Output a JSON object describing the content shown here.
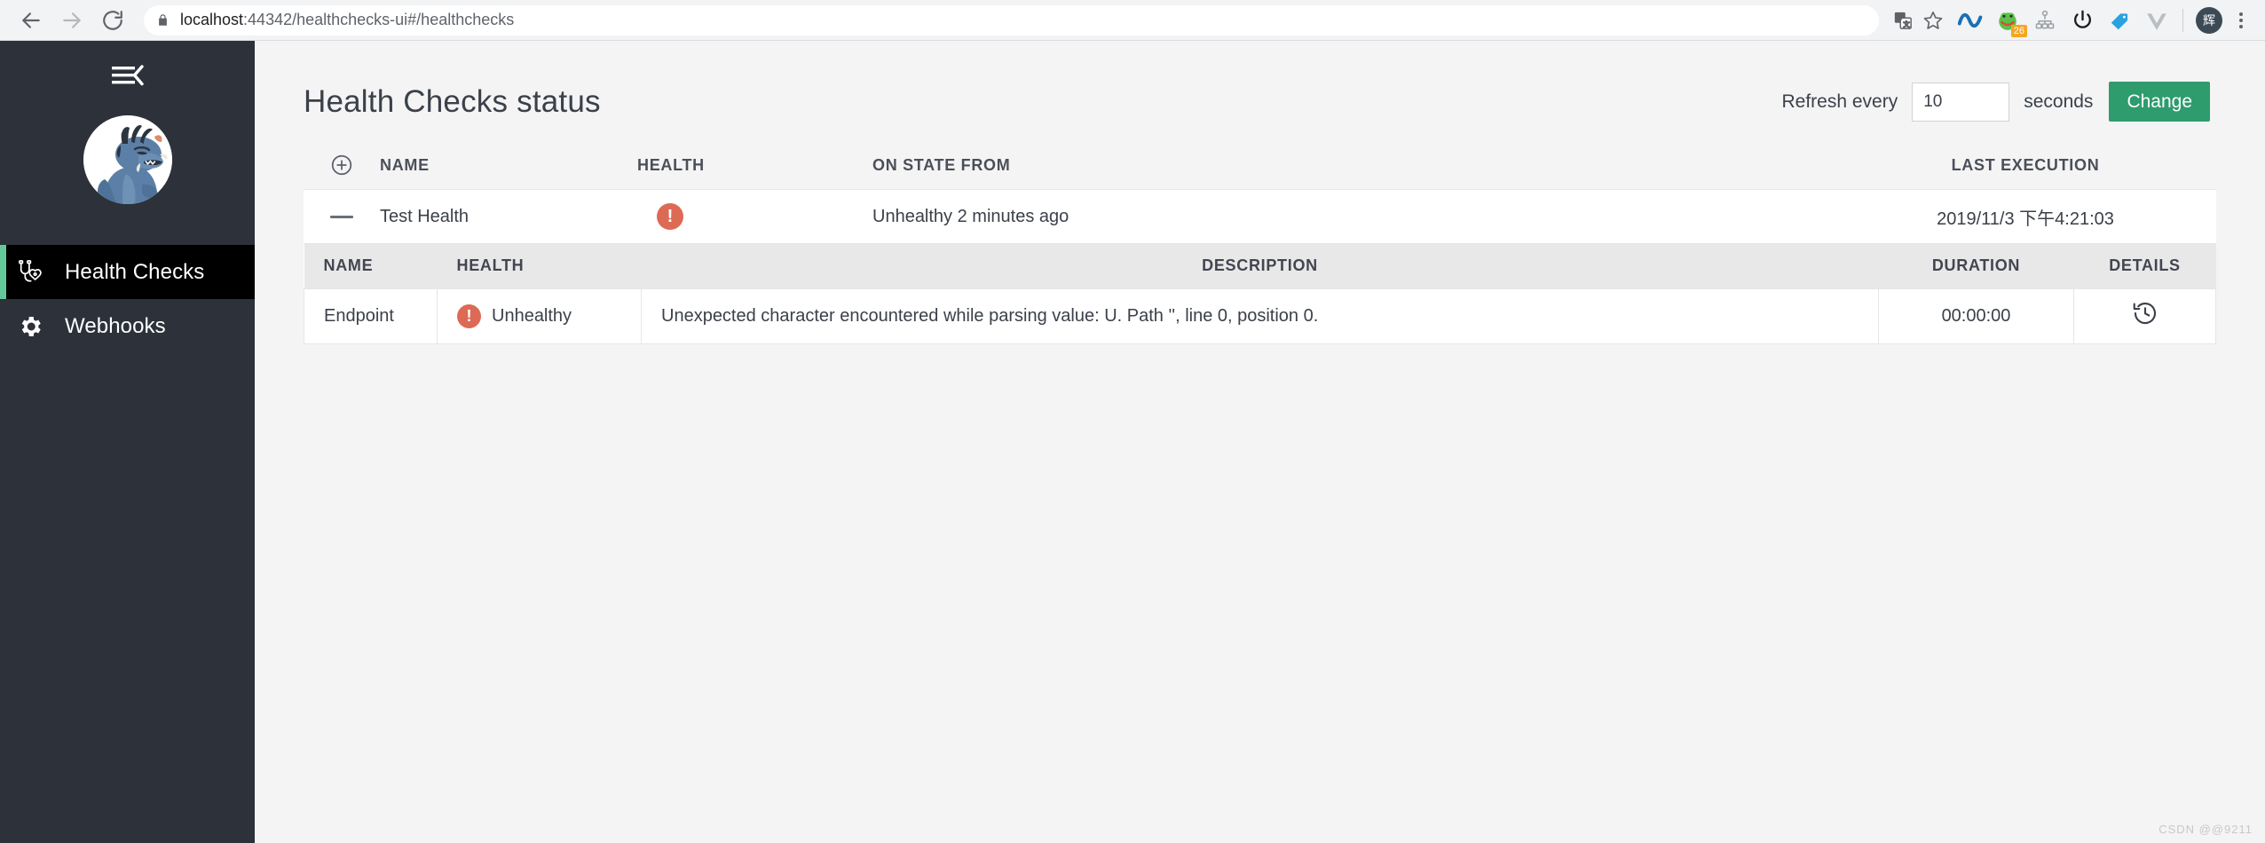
{
  "browser": {
    "back_tooltip": "Back",
    "forward_tooltip": "Forward",
    "reload_tooltip": "Reload",
    "url_host": "localhost",
    "url_rest": ":44342/healthchecks-ui#/healthchecks",
    "url_full": "localhost:44342/healthchecks-ui#/healthchecks",
    "extension_badge_count": "26",
    "profile_initial": "辉"
  },
  "sidebar": {
    "items": [
      {
        "label": "Health Checks",
        "icon": "stethoscope-heart-icon",
        "active": true
      },
      {
        "label": "Webhooks",
        "icon": "gear-icon",
        "active": false
      }
    ]
  },
  "header": {
    "title": "Health Checks status",
    "refresh_label": "Refresh every",
    "refresh_value": "10",
    "refresh_placeholder": "",
    "seconds_label": "seconds",
    "change_button": "Change"
  },
  "colors": {
    "accent_green": "#2e9c6d",
    "active_indicator": "#63c99a",
    "sidebar_bg": "#2c313a",
    "error_red": "#dd6a55",
    "page_bg": "#f4f4f5"
  },
  "outer_table": {
    "columns": [
      "",
      "NAME",
      "HEALTH",
      "ON STATE FROM",
      "LAST EXECUTION"
    ],
    "expand_icon": "plus-circle-icon",
    "rows": [
      {
        "toggle_icon": "minus-icon",
        "name": "Test Health",
        "health_icon": "error-exclamation-icon",
        "on_state_from": "Unhealthy 2 minutes ago",
        "last_execution": "2019/11/3 下午4:21:03"
      }
    ]
  },
  "inner_table": {
    "columns": [
      "NAME",
      "HEALTH",
      "DESCRIPTION",
      "DURATION",
      "DETAILS"
    ],
    "rows": [
      {
        "name": "Endpoint",
        "health_icon": "error-exclamation-icon",
        "health_label": "Unhealthy",
        "description": "Unexpected character encountered while parsing value: U. Path '', line 0, position 0.",
        "duration": "00:00:00",
        "details_icon": "history-clock-icon"
      }
    ]
  },
  "watermark": "CSDN @@9211"
}
